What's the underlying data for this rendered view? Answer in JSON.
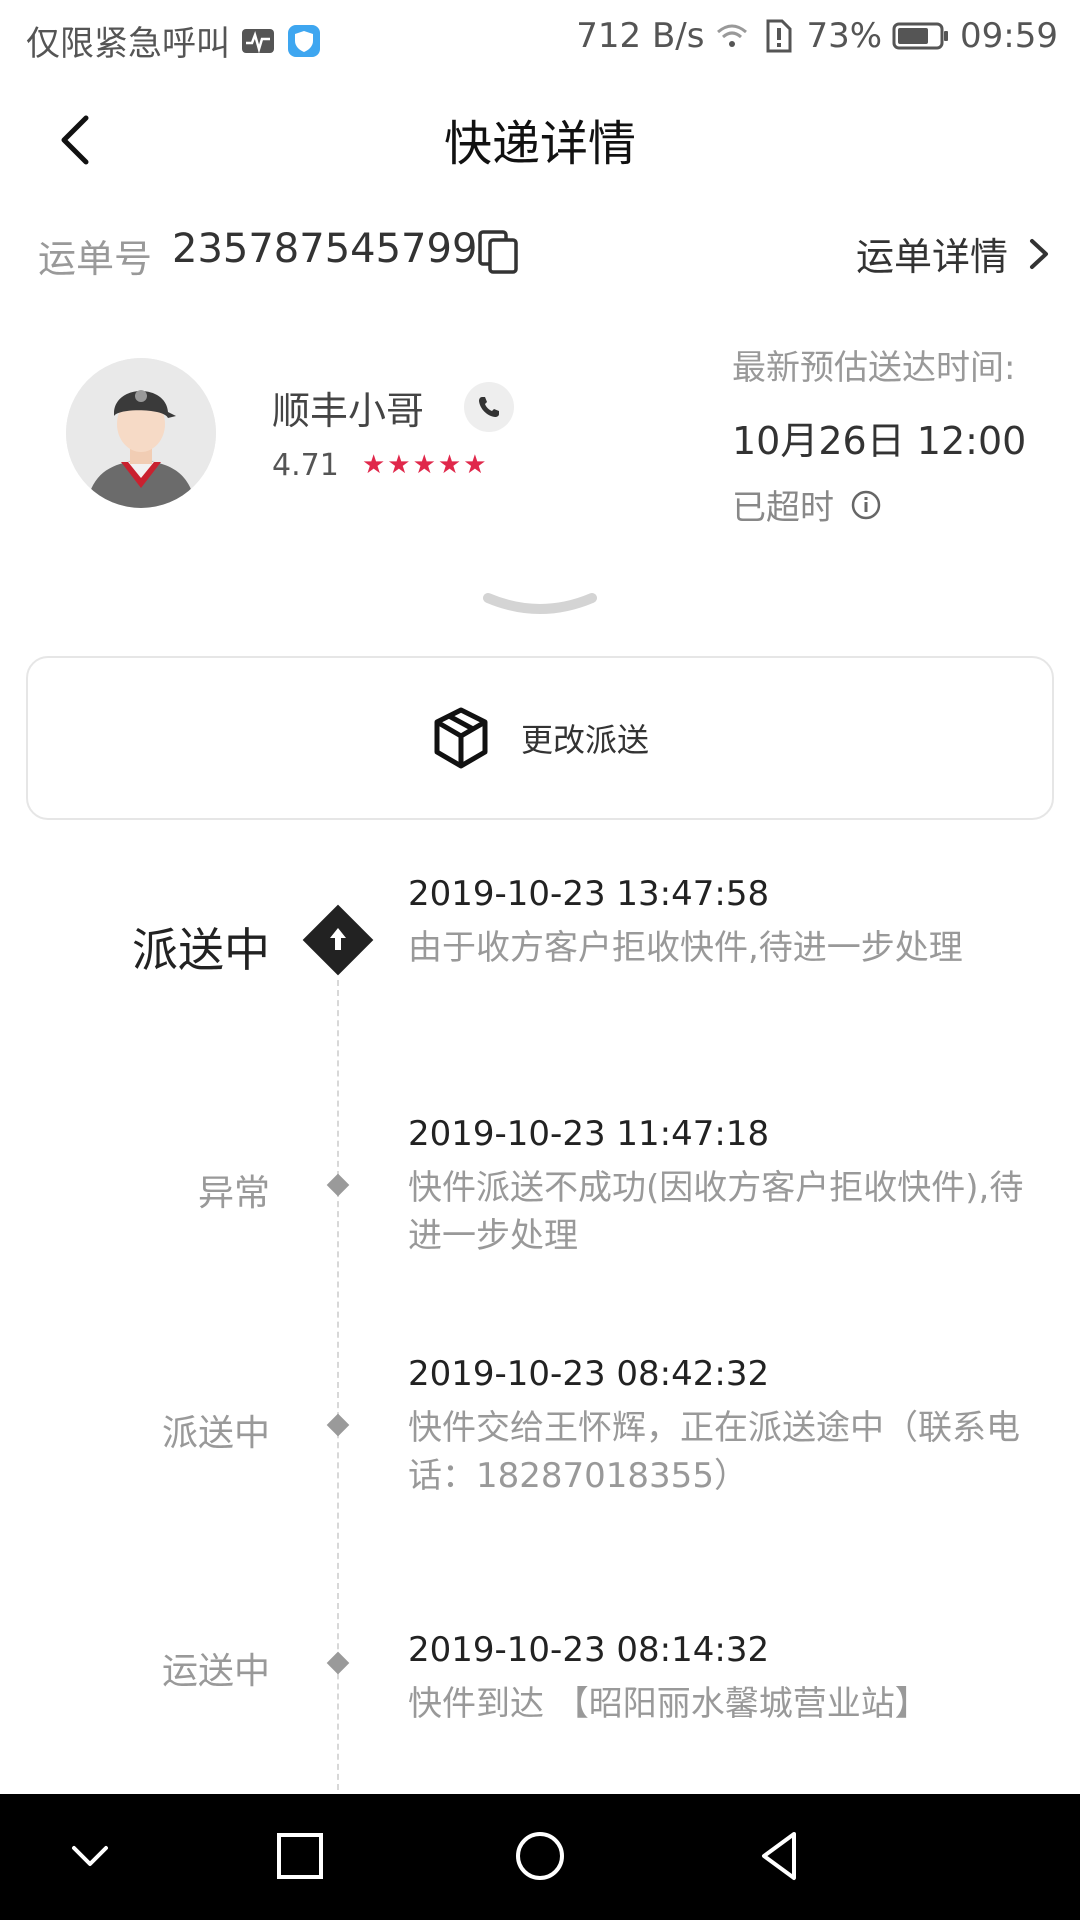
{
  "status_bar": {
    "carrier_text": "仅限紧急呼叫",
    "net_speed": "712 B/s",
    "battery": "73%",
    "time": "09:59"
  },
  "header": {
    "title": "快递详情"
  },
  "waybill": {
    "label": "运单号",
    "number": "235787545799",
    "detail_link": "运单详情"
  },
  "courier": {
    "name": "顺丰小哥",
    "rating": "4.71",
    "stars": "★★★★★",
    "eta_label": "最新预估送达时间:",
    "eta_value": "10月26日 12:00",
    "overdue": "已超时"
  },
  "change_delivery": {
    "label": "更改派送"
  },
  "timeline": [
    {
      "status": "派送中",
      "time": "2019-10-23 13:47:58",
      "desc": "由于收方客户拒收快件,待进一步处理",
      "active": true
    },
    {
      "status": "异常",
      "time": "2019-10-23 11:47:18",
      "desc": "快件派送不成功(因收方客户拒收快件),待进一步处理",
      "active": false
    },
    {
      "status": "派送中",
      "time": "2019-10-23 08:42:32",
      "desc": "快件交给王怀辉，正在派送途中（联系电话：18287018355）",
      "active": false
    },
    {
      "status": "运送中",
      "time": "2019-10-23 08:14:32",
      "desc": "快件到达 【昭阳丽水馨城营业站】",
      "active": false
    }
  ],
  "colors": {
    "star": "#e0284b",
    "active_node": "#222222",
    "node": "#9a9a9a"
  },
  "icons": [
    "back-arrow-icon",
    "copy-icon",
    "chevron-right-icon",
    "phone-icon",
    "info-icon",
    "box-icon",
    "arrow-up-icon",
    "nav-down-icon",
    "nav-home-icon",
    "nav-back-icon"
  ]
}
